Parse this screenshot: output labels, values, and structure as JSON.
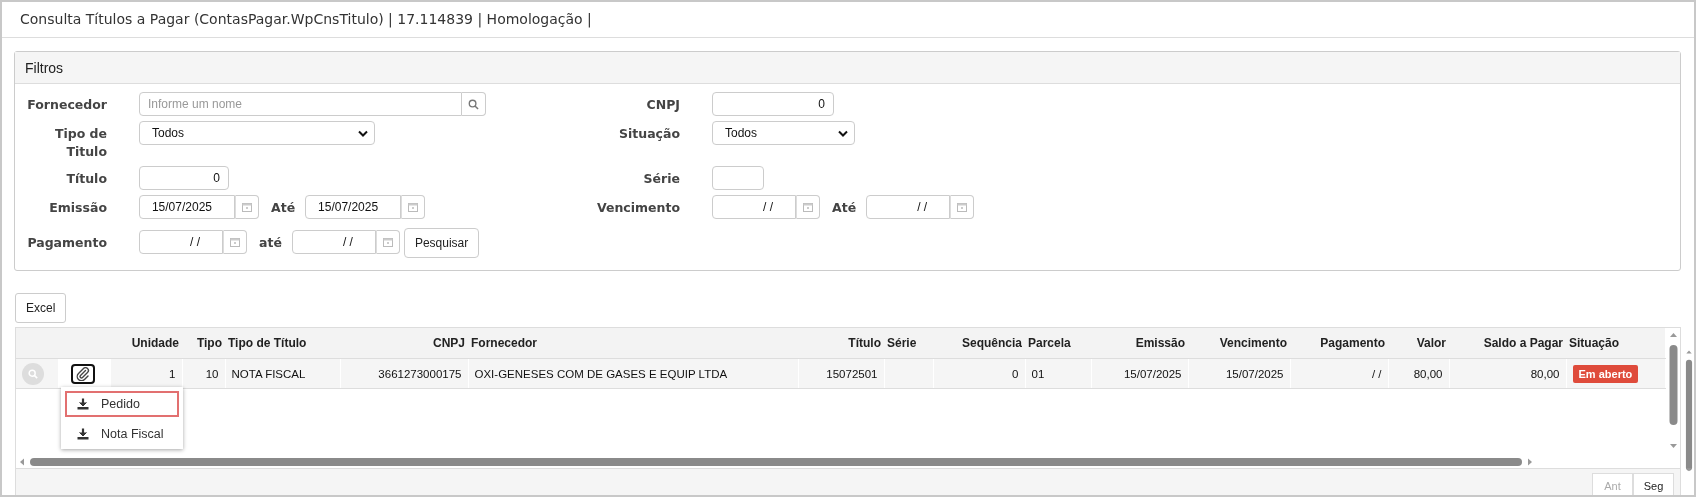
{
  "window": {
    "title": "Consulta Títulos a Pagar (ContasPagar.WpCnsTitulo) | 17.114839 | Homologação |"
  },
  "filters": {
    "title": "Filtros",
    "rows": [
      {
        "left": {
          "kind": "search",
          "label": "Fornecedor",
          "placeholder": "Informe um nome"
        },
        "right": {
          "kind": "text",
          "label": "CNPJ",
          "value": "0"
        }
      },
      {
        "left": {
          "kind": "select",
          "label": "Tipo de Titulo",
          "value": "Todos"
        },
        "right": {
          "kind": "select",
          "label": "Situação",
          "value": "Todos"
        }
      },
      {
        "left": {
          "kind": "text",
          "label": "Título",
          "value": "0"
        },
        "right": {
          "kind": "text",
          "label": "Série"
        }
      },
      {
        "left": {
          "kind": "daterange",
          "label": "Emissão",
          "from": "15/07/2025",
          "to_label": "Até",
          "to": "15/07/2025"
        },
        "right": {
          "kind": "daterange",
          "label": "Vencimento",
          "from": "/ /",
          "to_label": "Até",
          "to": "/ /"
        }
      },
      {
        "left": {
          "kind": "daterange",
          "label": "Pagamento",
          "from": "/ /",
          "to_label": "até",
          "to": "/ /",
          "button": "Pesquisar"
        }
      }
    ]
  },
  "toolbar": {
    "buttons": [
      "Excel"
    ]
  },
  "table": {
    "columns": [
      {
        "label": "Unidade",
        "kind": "number"
      },
      {
        "label": "Tipo",
        "kind": "number"
      },
      {
        "label": "Tipo de Título",
        "kind": "text"
      },
      {
        "label": "CNPJ",
        "kind": "number"
      },
      {
        "label": "Fornecedor",
        "kind": "text"
      },
      {
        "label": "Título",
        "kind": "number"
      },
      {
        "label": "Série",
        "kind": "text"
      },
      {
        "label": "Sequência",
        "kind": "number"
      },
      {
        "label": "Parcela",
        "kind": "text"
      },
      {
        "label": "Emissão",
        "kind": "number"
      },
      {
        "label": "Vencimento",
        "kind": "number"
      },
      {
        "label": "Pagamento",
        "kind": "number"
      },
      {
        "label": "Valor",
        "kind": "number"
      },
      {
        "label": "Saldo a Pagar",
        "kind": "number"
      },
      {
        "label": "Situação",
        "kind": "status"
      }
    ],
    "rows": [
      {
        "cells": [
          "1",
          "10",
          "NOTA FISCAL",
          "3661273000175",
          "OXI-GENESES COM DE GASES E EQUIP LTDA",
          "15072501",
          null,
          "0",
          "01",
          "15/07/2025",
          "15/07/2025",
          "/ /",
          "80,00",
          "80,00",
          "Em aberto"
        ]
      }
    ]
  },
  "attachment_menu": {
    "items": [
      {
        "label": "Pedido",
        "selected": true
      },
      {
        "label": "Nota Fiscal",
        "selected": false
      }
    ]
  },
  "pager": {
    "buttons": [
      {
        "label": "Ant",
        "disabled": true
      },
      {
        "label": "Seg",
        "disabled": false
      }
    ]
  }
}
